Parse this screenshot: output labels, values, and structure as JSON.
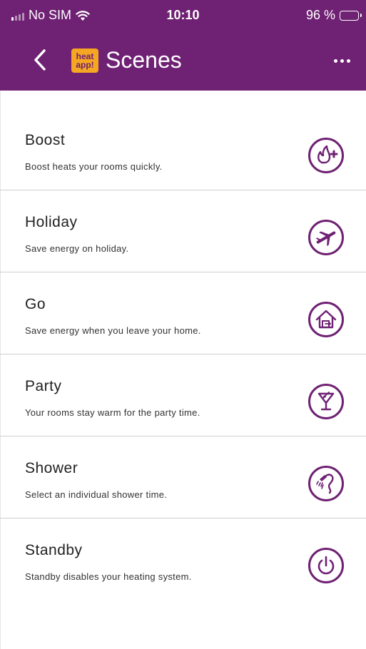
{
  "status": {
    "carrier": "No SIM",
    "time": "10:10",
    "battery": "96 %",
    "battery_level": 0.96
  },
  "nav": {
    "logo_line1": "heat",
    "logo_line2": "app!",
    "title": "Scenes"
  },
  "colors": {
    "brand": "#6f2173",
    "logo_bg": "#f5a623"
  },
  "scenes": [
    {
      "title": "Boost",
      "desc": "Boost heats your rooms quickly.",
      "icon": "boost-flame-icon"
    },
    {
      "title": "Holiday",
      "desc": "Save energy on holiday.",
      "icon": "airplane-icon"
    },
    {
      "title": "Go",
      "desc": "Save energy when you leave your home.",
      "icon": "house-exit-icon"
    },
    {
      "title": "Party",
      "desc": "Your rooms stay warm for the party time.",
      "icon": "cocktail-icon"
    },
    {
      "title": "Shower",
      "desc": "Select an individual shower time.",
      "icon": "shower-icon"
    },
    {
      "title": "Standby",
      "desc": "Standby disables your heating system.",
      "icon": "power-icon"
    }
  ]
}
